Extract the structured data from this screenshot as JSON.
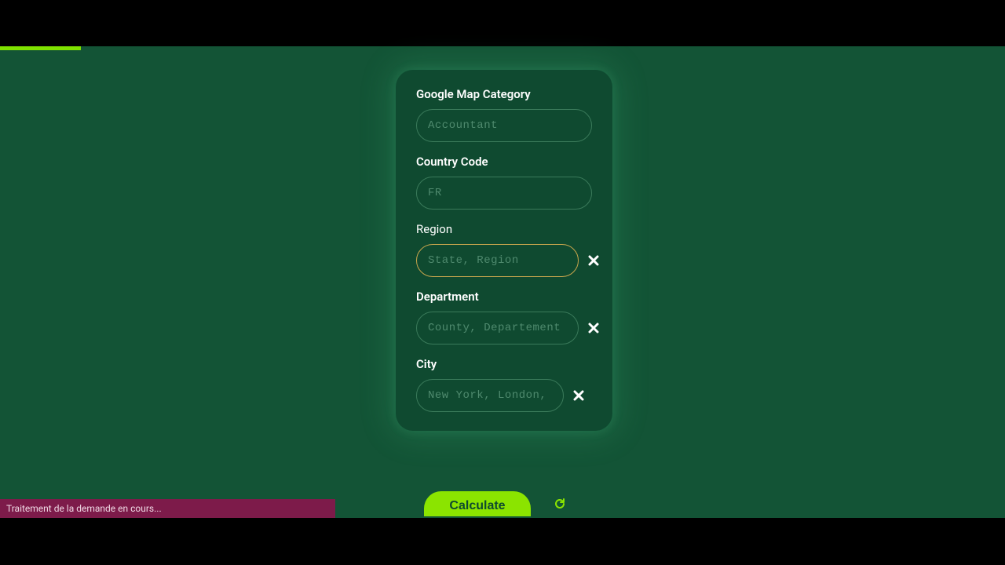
{
  "form": {
    "category": {
      "label": "Google Map Category",
      "placeholder": "Accountant",
      "value": ""
    },
    "country": {
      "label": "Country Code",
      "placeholder": "FR",
      "value": ""
    },
    "region": {
      "label": "Region",
      "placeholder": "State, Region",
      "value": ""
    },
    "department": {
      "label": "Department",
      "placeholder": "County, Departement",
      "value": ""
    },
    "city": {
      "label": "City",
      "placeholder": "New York, London, Par",
      "value": ""
    }
  },
  "buttons": {
    "calculate": "Calculate"
  },
  "status": {
    "message": "Traitement de la demande en cours..."
  },
  "colors": {
    "bg": "#135436",
    "card": "#0f4a30",
    "accent": "#8be400",
    "status_bg": "#7d1b4a"
  }
}
